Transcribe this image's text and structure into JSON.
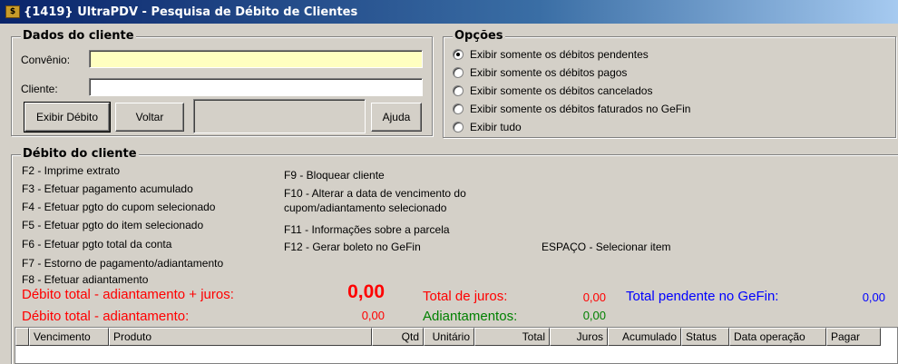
{
  "window": {
    "title": "{1419} UltraPDV - Pesquisa de Débito de Clientes",
    "icon": "app-icon"
  },
  "dados": {
    "legend": "Dados do cliente",
    "convenio_label": "Convênio:",
    "convenio_value": "",
    "cliente_label": "Cliente:",
    "cliente_value": "",
    "btn_exibir": "Exibir Débito",
    "btn_voltar": "Voltar",
    "btn_ajuda": "Ajuda"
  },
  "opcoes": {
    "legend": "Opções",
    "items": [
      {
        "label": "Exibir somente os débitos pendentes",
        "checked": true
      },
      {
        "label": "Exibir somente os débitos pagos",
        "checked": false
      },
      {
        "label": "Exibir somente os débitos cancelados",
        "checked": false
      },
      {
        "label": "Exibir somente os débitos faturados no GeFin",
        "checked": false
      },
      {
        "label": "Exibir tudo",
        "checked": false
      }
    ]
  },
  "debito": {
    "legend": "Débito do cliente",
    "shortcuts_left": [
      "F2 - Imprime extrato",
      "F3 - Efetuar pagamento acumulado",
      "F4 - Efetuar pgto do cupom selecionado",
      "F5 - Efetuar pgto do item selecionado",
      "F6 - Efetuar pgto total da conta",
      "F7 - Estorno de pagamento/adiantamento",
      "F8 - Efetuar adiantamento"
    ],
    "shortcuts_right": {
      "f9": "F9 - Bloquear cliente",
      "f10a": "F10 - Alterar a data de vencimento do",
      "f10b": "cupom/adiantamento selecionado",
      "f11": "F11 - Informações sobre a parcela",
      "f12": "F12 - Gerar boleto no GeFin",
      "espaco": "ESPAÇO - Selecionar item"
    },
    "totals": {
      "debito_juros_label": "Débito total - adiantamento + juros:",
      "debito_juros_value": "0,00",
      "debito_label": "Débito total - adiantamento:",
      "debito_value": "0,00",
      "juros_label": "Total de juros:",
      "juros_value": "0,00",
      "adiant_label": "Adiantamentos:",
      "adiant_value": "0,00",
      "gefin_label": "Total pendente no GeFin:",
      "gefin_value": "0,00"
    },
    "columns": [
      "",
      "Vencimento",
      "Produto",
      "Qtd",
      "Unitário",
      "Total",
      "Juros",
      "Acumulado",
      "Status",
      "Data operação",
      "Pagar"
    ]
  },
  "colors": {
    "red": "#ff0000",
    "green": "#008000",
    "blue": "#0000ff",
    "titlebar": "#0a246a"
  }
}
